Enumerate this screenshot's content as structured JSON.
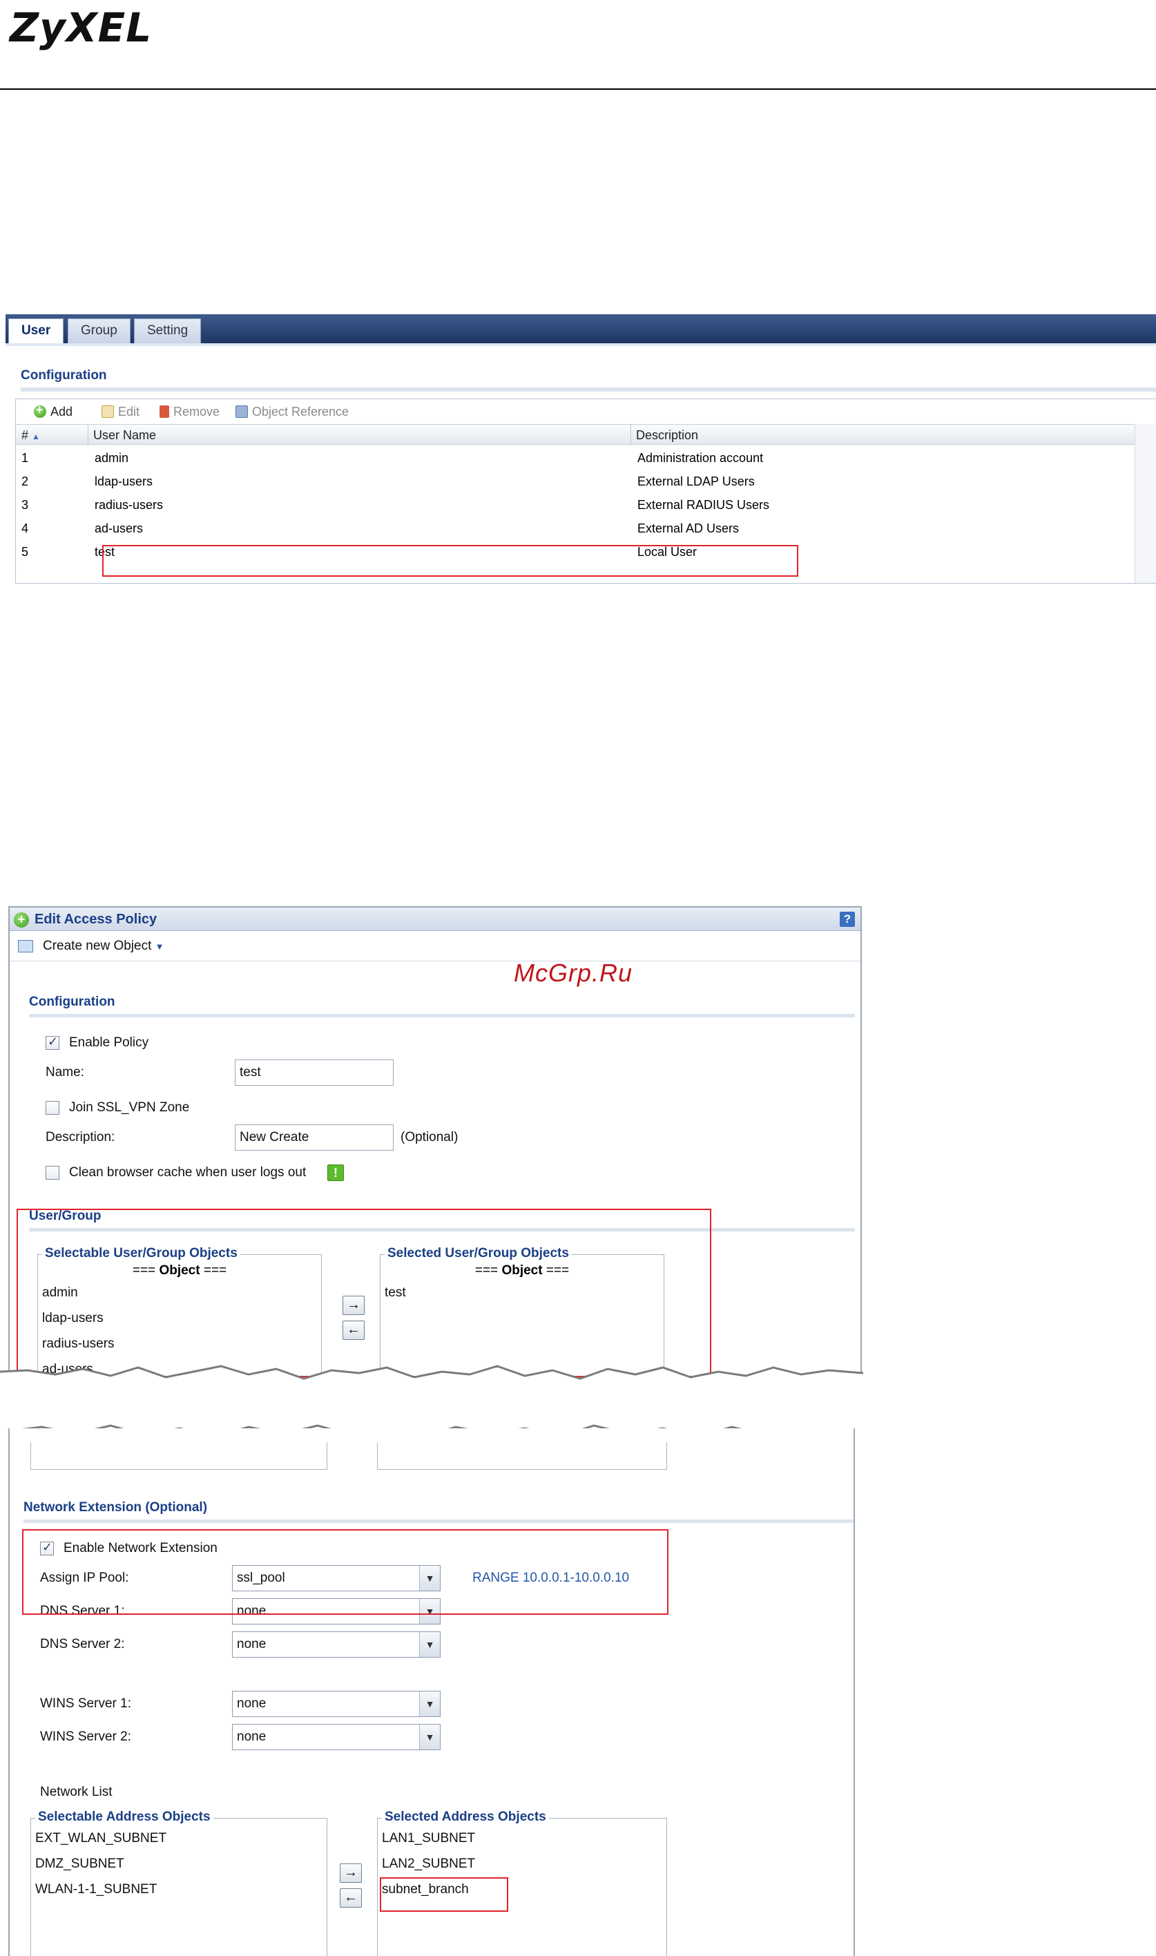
{
  "header": {
    "logo": "ZyXEL"
  },
  "watermark": "McGrp.Ru",
  "user_list": {
    "tabs": [
      "User",
      "Group",
      "Setting"
    ],
    "section_title": "Configuration",
    "toolbar": {
      "add": "Add",
      "edit": "Edit",
      "remove": "Remove",
      "object_reference": "Object Reference"
    },
    "columns": [
      "#",
      "User Name",
      "Description"
    ],
    "rows": [
      {
        "num": "1",
        "name": "admin",
        "desc": "Administration account"
      },
      {
        "num": "2",
        "name": "ldap-users",
        "desc": "External LDAP Users"
      },
      {
        "num": "3",
        "name": "radius-users",
        "desc": "External RADIUS Users"
      },
      {
        "num": "4",
        "name": "ad-users",
        "desc": "External AD Users"
      },
      {
        "num": "5",
        "name": "test",
        "desc": "Local User"
      }
    ]
  },
  "edit_policy": {
    "title": "Edit Access Policy",
    "help": "?",
    "create_new_object": "Create new Object",
    "config_title": "Configuration",
    "enable_policy": "Enable Policy",
    "name_label": "Name:",
    "name_value": "test",
    "join_ssl_vpn": "Join SSL_VPN Zone",
    "description_label": "Description:",
    "description_value": "New Create",
    "optional": "(Optional)",
    "clean_cache": "Clean browser cache when user logs out",
    "user_group_title": "User/Group",
    "selectable_caption": "Selectable User/Group Objects",
    "selected_caption": "Selected User/Group Objects",
    "object_header_prefix": "===",
    "object_header_word": "Object",
    "object_header_suffix": "===",
    "selectable_items": [
      "admin",
      "ldap-users",
      "radius-users",
      "ad-users"
    ],
    "selected_items": [
      "test"
    ],
    "arrow_right": "→",
    "arrow_left": "←"
  },
  "network_extension": {
    "title": "Network Extension (Optional)",
    "enable": "Enable Network Extension",
    "ip_pool_label": "Assign IP Pool:",
    "ip_pool_value": "ssl_pool",
    "range": "RANGE 10.0.0.1-10.0.0.10",
    "dns1_label": "DNS Server 1:",
    "dns1_value": "none",
    "dns2_label": "DNS Server 2:",
    "dns2_value": "none",
    "wins1_label": "WINS Server 1:",
    "wins1_value": "none",
    "wins2_label": "WINS Server 2:",
    "wins2_value": "none",
    "network_list_label": "Network List",
    "selectable_caption": "Selectable Address Objects",
    "selected_caption": "Selected Address Objects",
    "selectable_items": [
      "EXT_WLAN_SUBNET",
      "DMZ_SUBNET",
      "WLAN-1-1_SUBNET"
    ],
    "selected_items": [
      "LAN1_SUBNET",
      "LAN2_SUBNET",
      "subnet_branch"
    ],
    "arrow_right": "→",
    "arrow_left": "←"
  },
  "colors": {
    "highlight": "#e0242a",
    "title_blue": "#1a3f86",
    "tab_bar": "#1d3564"
  }
}
